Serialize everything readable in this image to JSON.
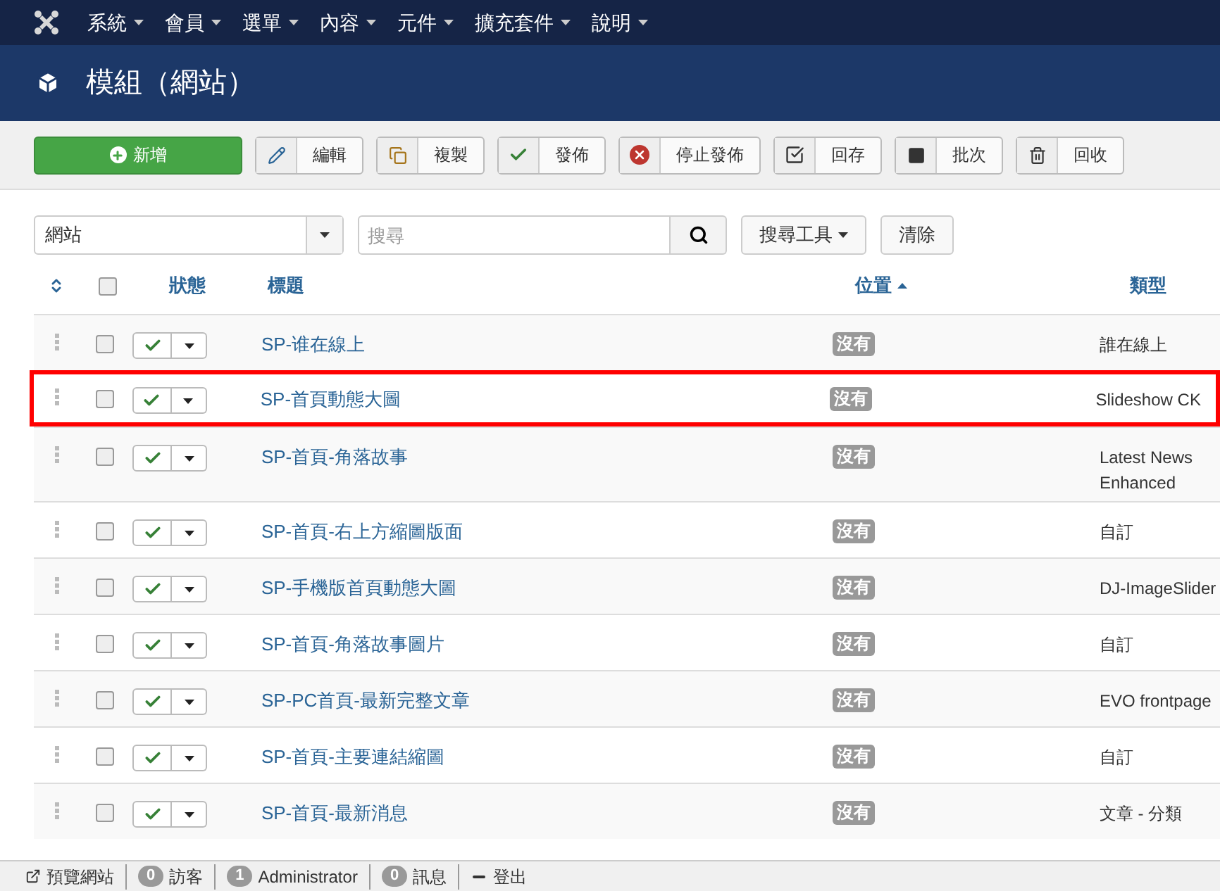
{
  "menu": [
    {
      "label": "系統"
    },
    {
      "label": "會員"
    },
    {
      "label": "選單"
    },
    {
      "label": "內容"
    },
    {
      "label": "元件"
    },
    {
      "label": "擴充套件"
    },
    {
      "label": "說明"
    }
  ],
  "page_title": "模組（網站）",
  "toolbar": [
    {
      "kind": "new",
      "label": "新增"
    },
    {
      "kind": "edit",
      "label": "編輯"
    },
    {
      "kind": "copy",
      "label": "複製"
    },
    {
      "kind": "publish",
      "label": "發佈"
    },
    {
      "kind": "unpublish",
      "label": "停止發佈"
    },
    {
      "kind": "checkin",
      "label": "回存"
    },
    {
      "kind": "batch",
      "label": "批次"
    },
    {
      "kind": "trash",
      "label": "回收"
    }
  ],
  "filter": {
    "client": "網站",
    "search_placeholder": "搜尋",
    "tools": "搜尋工具",
    "clear": "清除"
  },
  "select_all": {
    "checked": false
  },
  "columns": {
    "status": "狀態",
    "title": "標題",
    "position": "位置",
    "type": "類型"
  },
  "rows": [
    {
      "title": "SP-谁在線上",
      "position": "沒有",
      "type": "誰在線上",
      "published": true,
      "selected": false
    },
    {
      "title": "SP-首頁動態大圖",
      "position": "沒有",
      "type": "Slideshow CK",
      "published": true,
      "selected": true
    },
    {
      "title": "SP-首頁-角落故事",
      "position": "沒有",
      "type": "Latest News Enhanced",
      "published": true,
      "selected": false
    },
    {
      "title": "SP-首頁-右上方縮圖版面",
      "position": "沒有",
      "type": "自訂",
      "published": true,
      "selected": false
    },
    {
      "title": "SP-手機版首頁動態大圖",
      "position": "沒有",
      "type": "DJ-ImageSlider",
      "published": true,
      "selected": false
    },
    {
      "title": "SP-首頁-角落故事圖片",
      "position": "沒有",
      "type": "自訂",
      "published": true,
      "selected": false
    },
    {
      "title": "SP-PC首頁-最新完整文章",
      "position": "沒有",
      "type": "EVO frontpage",
      "published": true,
      "selected": false
    },
    {
      "title": "SP-首頁-主要連結縮圖",
      "position": "沒有",
      "type": "自訂",
      "published": true,
      "selected": false
    },
    {
      "title": "SP-首頁-最新消息",
      "position": "沒有",
      "type": "文章 - 分類",
      "published": true,
      "selected": false
    }
  ],
  "status_bar": [
    {
      "kind": "link",
      "label": "預覽網站"
    },
    {
      "kind": "count",
      "count": "0",
      "label": "訪客"
    },
    {
      "kind": "count",
      "count": "1",
      "label": "Administrator"
    },
    {
      "kind": "count",
      "count": "0",
      "label": "訊息"
    },
    {
      "kind": "logout",
      "label": "登出"
    }
  ]
}
